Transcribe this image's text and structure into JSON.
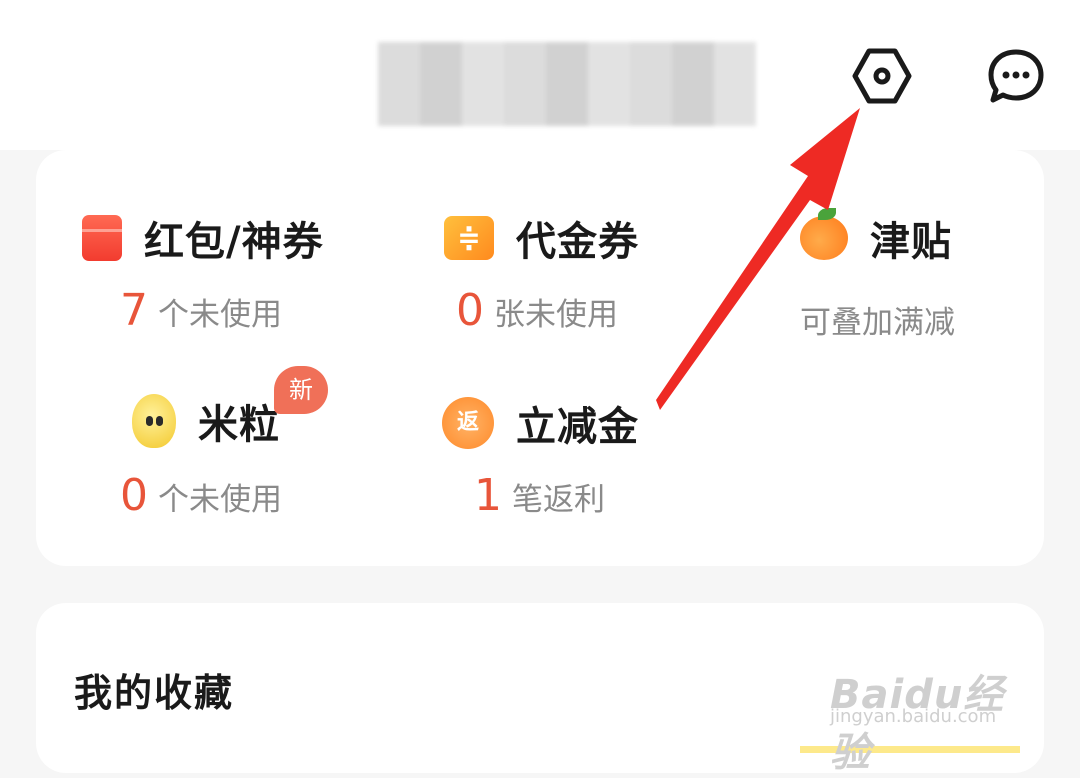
{
  "header": {
    "settings_icon": "settings-hexagon-icon",
    "message_icon": "chat-bubble-icon"
  },
  "benefits": {
    "items": [
      {
        "title": "红包/神券",
        "count": "7",
        "suffix": "个未使用",
        "icon": "red-packet-icon"
      },
      {
        "title": "代金券",
        "count": "0",
        "suffix": "张未使用",
        "icon": "voucher-icon",
        "icon_glyph": "≑"
      },
      {
        "title": "津贴",
        "count": "",
        "suffix": "可叠加满减",
        "icon": "orange-fruit-icon"
      },
      {
        "title": "米粒",
        "count": "0",
        "suffix": "个未使用",
        "icon": "rice-grain-icon",
        "badge": "新"
      },
      {
        "title": "立减金",
        "count": "1",
        "suffix": "笔返利",
        "icon": "cashback-icon",
        "icon_glyph": "返"
      }
    ]
  },
  "favorites": {
    "title": "我的收藏"
  },
  "watermark": {
    "main": "Baidu经验",
    "sub": "jingyan.baidu.com"
  },
  "colors": {
    "accent_number": "#e8553a",
    "annotation_arrow": "#ee2a24",
    "badge": "#f07058"
  }
}
